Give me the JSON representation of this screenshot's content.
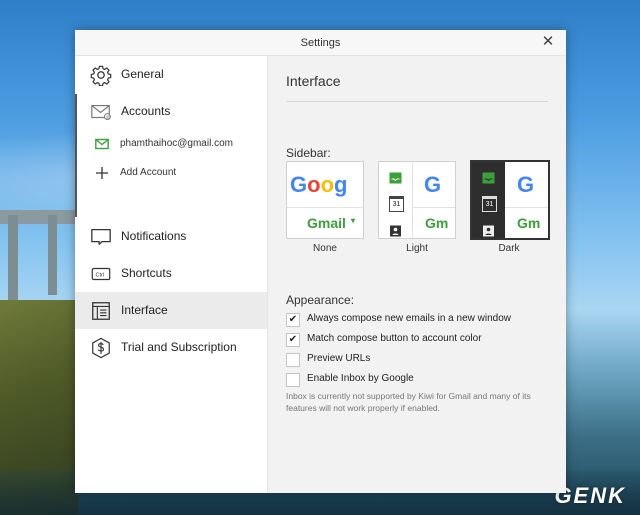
{
  "window": {
    "title": "Settings"
  },
  "sidebar": {
    "items": [
      {
        "label": "General",
        "icon": "gear-icon"
      },
      {
        "label": "Accounts",
        "icon": "envelope-icon"
      },
      {
        "label": "Notifications",
        "icon": "speech-bubble-icon"
      },
      {
        "label": "Shortcuts",
        "icon": "keyboard-ctrl-icon",
        "icon_text": "Ctrl"
      },
      {
        "label": "Interface",
        "icon": "layout-icon",
        "active": true
      },
      {
        "label": "Trial and Subscription",
        "icon": "dollar-icon"
      }
    ],
    "account_email": "phamthaihoc@gmail.com",
    "add_account": "Add Account"
  },
  "panel": {
    "title": "Interface",
    "sidebar_label": "Sidebar:",
    "sidebar_options": [
      {
        "label": "None",
        "preview_top": "Goog",
        "preview_bottom": "Gmail",
        "selected": false
      },
      {
        "label": "Light",
        "preview_top": "G",
        "preview_bottom": "Gm",
        "calendar_day": "31",
        "selected": false
      },
      {
        "label": "Dark",
        "preview_top": "G",
        "preview_bottom": "Gm",
        "calendar_day": "31",
        "selected": true
      }
    ],
    "appearance_label": "Appearance:",
    "options": [
      {
        "label": "Always compose new emails in a new window",
        "checked": true
      },
      {
        "label": "Match compose button to account color",
        "checked": true
      },
      {
        "label": "Preview URLs",
        "checked": false
      },
      {
        "label": "Enable Inbox by Google",
        "checked": false
      }
    ],
    "note": "Inbox is currently not supported by Kiwi for Gmail and many of its features will not work properly if enabled."
  },
  "watermark": "GENK",
  "colors": {
    "accent_green": "#3aa13a",
    "dark_strip": "#2e2e2e",
    "google_blue": "#4285F4",
    "google_red": "#EA4335",
    "google_yellow": "#FBBC05",
    "google_green": "#34A853"
  }
}
